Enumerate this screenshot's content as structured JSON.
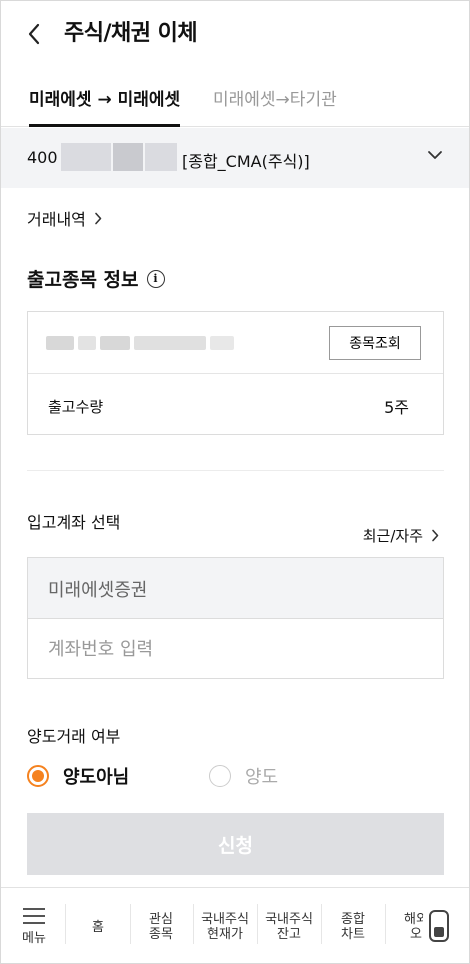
{
  "header": {
    "title": "주식/채권 이체",
    "back_icon": "chevron-left-icon"
  },
  "tabs": [
    {
      "label": "미래에셋 → 미래에셋",
      "active": true
    },
    {
      "label": "미래에셋→타기관",
      "active": false
    }
  ],
  "account": {
    "number_prefix": "400",
    "type": "[종합_CMA(주식)]",
    "dropdown_icon": "chevron-down-icon"
  },
  "history_link": {
    "label": "거래내역",
    "icon": "chevron-right-icon"
  },
  "outgoing": {
    "title": "출고종목 정보",
    "info_icon": "info-icon",
    "lookup_button": "종목조회",
    "quantity_label": "출고수량",
    "quantity_value": "5주"
  },
  "incoming": {
    "title": "입고계좌 선택",
    "recent_link": "최근/자주",
    "institution": "미래에셋증권",
    "account_placeholder": "계좌번호 입력"
  },
  "transfer_type": {
    "label": "양도거래 여부",
    "options": [
      {
        "label": "양도아님",
        "selected": true
      },
      {
        "label": "양도",
        "selected": false
      }
    ]
  },
  "submit_label": "신청",
  "colors": {
    "accent": "#f5821f",
    "button_disabled": "#dedfe2",
    "panel": "#f3f4f6"
  },
  "bottom_nav": {
    "menu": "메뉴",
    "items": [
      "홈",
      "관심\n종목",
      "국내주식\n현재가",
      "국내주식\n잔고",
      "종합\n차트",
      "해외\n오"
    ]
  }
}
